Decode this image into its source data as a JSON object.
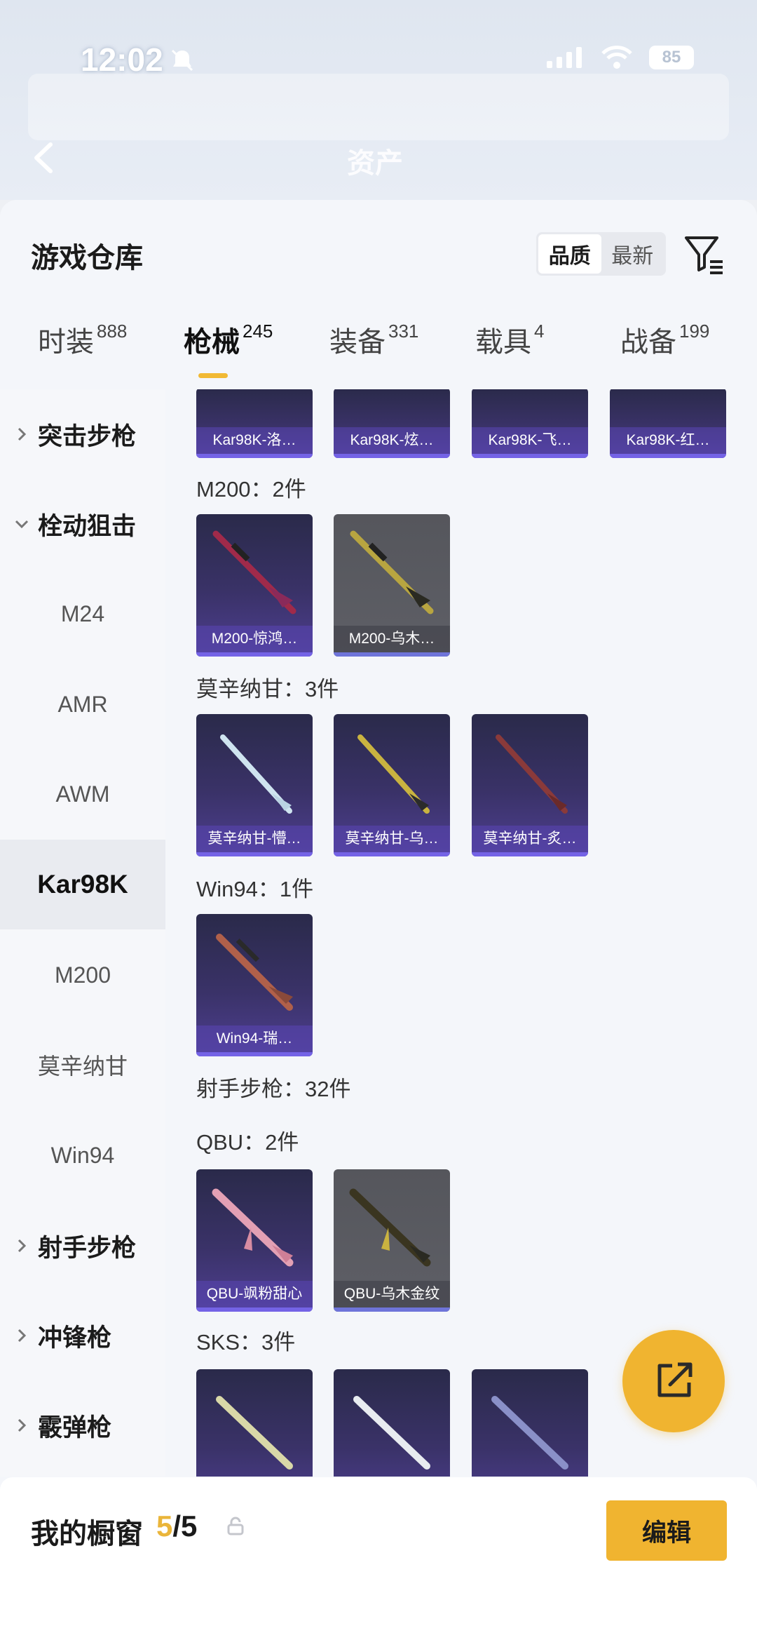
{
  "status_bar": {
    "time": "12:02",
    "battery": "85"
  },
  "background": {
    "title": "资产"
  },
  "sheet": {
    "title": "游戏仓库",
    "sort_options": [
      "品质",
      "最新"
    ],
    "tabs": [
      {
        "label": "时装",
        "count": "888"
      },
      {
        "label": "枪械",
        "count": "245"
      },
      {
        "label": "装备",
        "count": "331"
      },
      {
        "label": "载具",
        "count": "4"
      },
      {
        "label": "战备",
        "count": "199"
      }
    ]
  },
  "sidebar": {
    "items": [
      {
        "label": "突击步枪"
      },
      {
        "label": "栓动狙击"
      },
      {
        "label": "M24"
      },
      {
        "label": "AMR"
      },
      {
        "label": "AWM"
      },
      {
        "label": "Kar98K"
      },
      {
        "label": "M200"
      },
      {
        "label": "莫辛纳甘"
      },
      {
        "label": "Win94"
      },
      {
        "label": "射手步枪"
      },
      {
        "label": "冲锋枪"
      },
      {
        "label": "霰弹枪"
      }
    ]
  },
  "content": {
    "top_cards": [
      "Kar98K-洛…",
      "Kar98K-炫…",
      "Kar98K-飞…",
      "Kar98K-红…"
    ],
    "sections": [
      {
        "label": "M200：2件",
        "cards": [
          "M200-惊鸿…",
          "M200-乌木…"
        ]
      },
      {
        "label": "莫辛纳甘：3件",
        "cards": [
          "莫辛纳甘-懵…",
          "莫辛纳甘-乌…",
          "莫辛纳甘-炙…"
        ]
      },
      {
        "label": "Win94：1件",
        "cards": [
          "Win94-瑞…"
        ]
      },
      {
        "label": "射手步枪：32件"
      },
      {
        "label": "QBU：2件",
        "cards": [
          "QBU-飒粉甜心",
          "QBU-乌木金纹"
        ]
      },
      {
        "label": "SKS：3件"
      }
    ]
  },
  "bottom_bar": {
    "label": "我的橱窗",
    "count_current": "5",
    "count_total": "/5",
    "edit_label": "编辑"
  },
  "colors": {
    "accent": "#f0b430",
    "card_purple": "#4e3f91",
    "card_gray": "#5e5f66"
  }
}
